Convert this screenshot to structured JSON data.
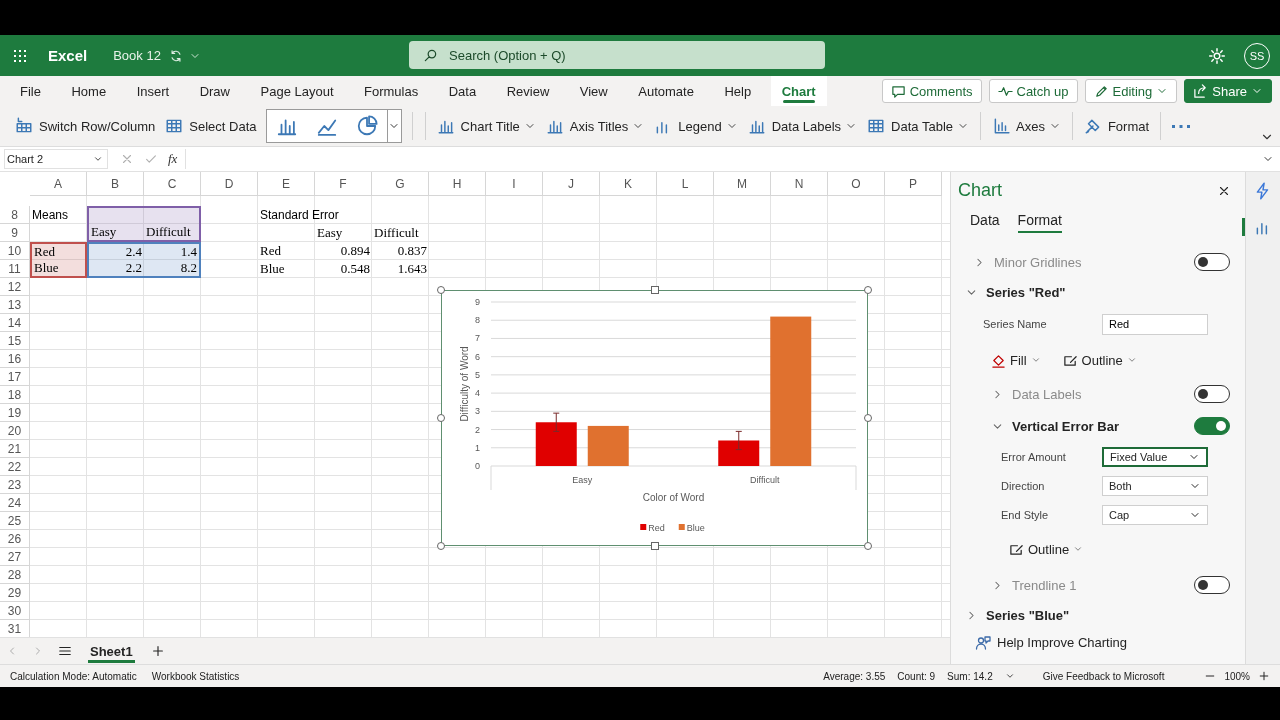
{
  "header": {
    "app_name": "Excel",
    "file_name": "Book 12",
    "search": {
      "placeholder": "Search (Option + Q)"
    },
    "avatar": "SS"
  },
  "ribbon": {
    "tabs": [
      {
        "label": "File",
        "selected": false
      },
      {
        "label": "Home",
        "selected": false
      },
      {
        "label": "Insert",
        "selected": false
      },
      {
        "label": "Draw",
        "selected": false
      },
      {
        "label": "Page Layout",
        "selected": false
      },
      {
        "label": "Formulas",
        "selected": false
      },
      {
        "label": "Data",
        "selected": false
      },
      {
        "label": "Review",
        "selected": false
      },
      {
        "label": "View",
        "selected": false
      },
      {
        "label": "Automate",
        "selected": false
      },
      {
        "label": "Help",
        "selected": false
      },
      {
        "label": "Chart",
        "selected": true
      }
    ],
    "actions": [
      {
        "label": "Comments",
        "kind": "plain"
      },
      {
        "label": "Catch up",
        "kind": "plain"
      },
      {
        "label": "Editing",
        "kind": "menu"
      },
      {
        "label": "Share",
        "kind": "primary"
      }
    ]
  },
  "toolbar": {
    "items": [
      {
        "kind": "button",
        "label": "Switch Row/Column"
      },
      {
        "kind": "button",
        "label": "Select Data"
      },
      {
        "kind": "gallery"
      },
      {
        "kind": "menu",
        "label": "Chart Title"
      },
      {
        "kind": "menu",
        "label": "Axis Titles"
      },
      {
        "kind": "menu",
        "label": "Legend"
      },
      {
        "kind": "menu",
        "label": "Data Labels"
      },
      {
        "kind": "menu",
        "label": "Data Table"
      },
      {
        "kind": "menu",
        "label": "Axes"
      },
      {
        "kind": "button",
        "label": "Format"
      },
      {
        "kind": "more"
      }
    ]
  },
  "formula_bar": {
    "name_box": "Chart 2",
    "function_label": "fx"
  },
  "sheet": {
    "columns": [
      "A",
      "B",
      "C",
      "D",
      "E",
      "F",
      "G",
      "H",
      "I",
      "J",
      "K",
      "L",
      "M",
      "N",
      "O",
      "P"
    ],
    "rows": [
      {
        "number": "8",
        "cells": [
          {
            "kind": "title",
            "text": "Means"
          },
          {
            "kind": "empty",
            "color": "#7f5fa8"
          },
          {
            "kind": "empty",
            "color": "#7f5fa8"
          },
          {
            "kind": "empty"
          },
          {
            "kind": "title",
            "text": "Standard Error"
          }
        ]
      },
      {
        "number": "9",
        "cells": [
          {
            "kind": "empty"
          },
          {
            "kind": "label",
            "text": "Easy",
            "color": "#7f5fa8"
          },
          {
            "kind": "label",
            "text": "Difficult",
            "color": "#7f5fa8"
          },
          {
            "kind": "empty"
          },
          {
            "kind": "empty"
          },
          {
            "kind": "label",
            "text": "Easy"
          },
          {
            "kind": "label",
            "text": "Difficult"
          }
        ]
      },
      {
        "number": "10",
        "cells": [
          {
            "kind": "label",
            "text": "Red",
            "color": "#c0504d"
          },
          {
            "kind": "number",
            "text": "2.4",
            "color": "#4f81bd"
          },
          {
            "kind": "number",
            "text": "1.4",
            "color": "#4f81bd"
          },
          {
            "kind": "empty"
          },
          {
            "kind": "label",
            "text": "Red"
          },
          {
            "kind": "number",
            "text": "0.894"
          },
          {
            "kind": "number",
            "text": "0.837"
          }
        ]
      },
      {
        "number": "11",
        "cells": [
          {
            "kind": "label",
            "text": "Blue",
            "color": "#c0504d"
          },
          {
            "kind": "number",
            "text": "2.2",
            "color": "#4f81bd"
          },
          {
            "kind": "number",
            "text": "8.2",
            "color": "#4f81bd"
          },
          {
            "kind": "empty"
          },
          {
            "kind": "label",
            "text": "Blue"
          },
          {
            "kind": "number",
            "text": "0.548"
          },
          {
            "kind": "number",
            "text": "1.643"
          }
        ]
      },
      {
        "number": "12"
      },
      {
        "number": "13"
      },
      {
        "number": "14"
      },
      {
        "number": "15"
      },
      {
        "number": "16"
      },
      {
        "number": "17"
      },
      {
        "number": "18"
      },
      {
        "number": "19"
      },
      {
        "number": "20"
      },
      {
        "number": "21"
      },
      {
        "number": "22"
      },
      {
        "number": "23"
      },
      {
        "number": "24"
      },
      {
        "number": "25"
      },
      {
        "number": "26"
      },
      {
        "number": "27"
      },
      {
        "number": "28"
      },
      {
        "number": "29"
      },
      {
        "number": "30"
      },
      {
        "number": "31"
      }
    ]
  },
  "chart": {
    "selected": true,
    "chart_data": {
      "type": "bar",
      "xlabel": "Color of Word",
      "ylabel": "Difficulty of Word",
      "categories": [
        "Easy",
        "Difficult"
      ],
      "series": [
        {
          "name": "Red",
          "color": "#e00000",
          "values": [
            2.4,
            1.4
          ]
        },
        {
          "name": "Blue",
          "color": "#e0712f",
          "values": [
            2.2,
            8.2
          ]
        }
      ],
      "ylim": [
        0,
        9
      ],
      "yticks": [
        0,
        1,
        2,
        3,
        4,
        5,
        6,
        7,
        8,
        9
      ],
      "grid": true,
      "legend": "bottom"
    }
  },
  "panel": {
    "title": "Chart",
    "tabs": [
      {
        "label": "Data",
        "selected": false
      },
      {
        "label": "Format",
        "selected": true
      }
    ],
    "items": [
      {
        "kind": "toggle",
        "label": "Minor Gridlines",
        "on": false,
        "expanded": false
      },
      {
        "kind": "section",
        "label": "Series \"Red\"",
        "expanded": true,
        "children": [
          {
            "kind": "text_field",
            "label": "Series Name",
            "value": "Red"
          },
          {
            "kind": "format_buttons",
            "buttons": [
              "Fill",
              "Outline"
            ]
          },
          {
            "kind": "toggle",
            "label": "Data Labels",
            "on": false,
            "expanded": false
          },
          {
            "kind": "toggle",
            "label": "Vertical Error Bar",
            "on": true,
            "expanded": true,
            "children": [
              {
                "kind": "dropdown",
                "label": "Error Amount",
                "value": "Fixed Value",
                "focused": true
              },
              {
                "kind": "dropdown",
                "label": "Direction",
                "value": "Both",
                "focused": false
              },
              {
                "kind": "dropdown",
                "label": "End Style",
                "value": "Cap",
                "focused": false
              },
              {
                "kind": "format_buttons",
                "buttons": [
                  "Outline"
                ]
              }
            ]
          },
          {
            "kind": "toggle",
            "label": "Trendline 1",
            "on": false,
            "expanded": false
          }
        ]
      },
      {
        "kind": "section",
        "label": "Series \"Blue\"",
        "expanded": false
      }
    ],
    "footer_link": "Help Improve Charting"
  },
  "sheet_tabs": [
    {
      "label": "Sheet1",
      "selected": true
    }
  ],
  "status_bar": {
    "left": [
      "Calculation Mode: Automatic",
      "Workbook Statistics"
    ],
    "stats": [
      "Average: 3.55",
      "Count: 9",
      "Sum: 14.2"
    ],
    "feedback": "Give Feedback to Microsoft",
    "zoom": "100%"
  }
}
